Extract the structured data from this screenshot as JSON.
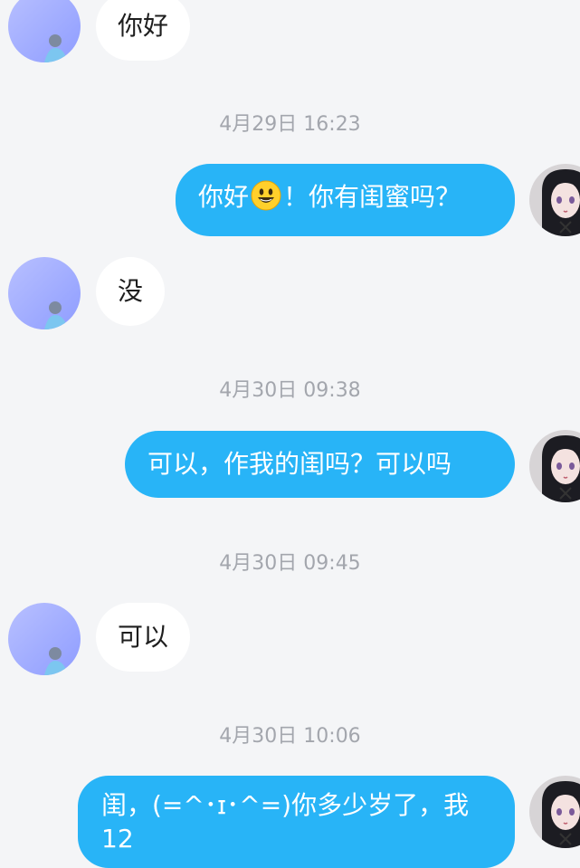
{
  "messages": [
    {
      "kind": "received",
      "text": "你好"
    },
    {
      "kind": "timestamp",
      "text": "4月29日 16:23"
    },
    {
      "kind": "sent",
      "text_before": "你好",
      "emoji": "smiley-emoji",
      "text_after": "！你有闺蜜吗？"
    },
    {
      "kind": "received",
      "text": "没"
    },
    {
      "kind": "timestamp",
      "text": "4月30日 09:38"
    },
    {
      "kind": "sent",
      "text": "可以，作我的闺吗？可以吗"
    },
    {
      "kind": "timestamp",
      "text": "4月30日 09:45"
    },
    {
      "kind": "received",
      "text": "可以"
    },
    {
      "kind": "timestamp",
      "text": "4月30日 10:06"
    },
    {
      "kind": "sent",
      "text": "闺，(=^･ɪ･^=)你多少岁了，我12"
    }
  ],
  "colors": {
    "background": "#f4f5f7",
    "sent_bubble": "#28b4f7",
    "received_bubble": "#ffffff",
    "timestamp": "#a3a6ad"
  }
}
